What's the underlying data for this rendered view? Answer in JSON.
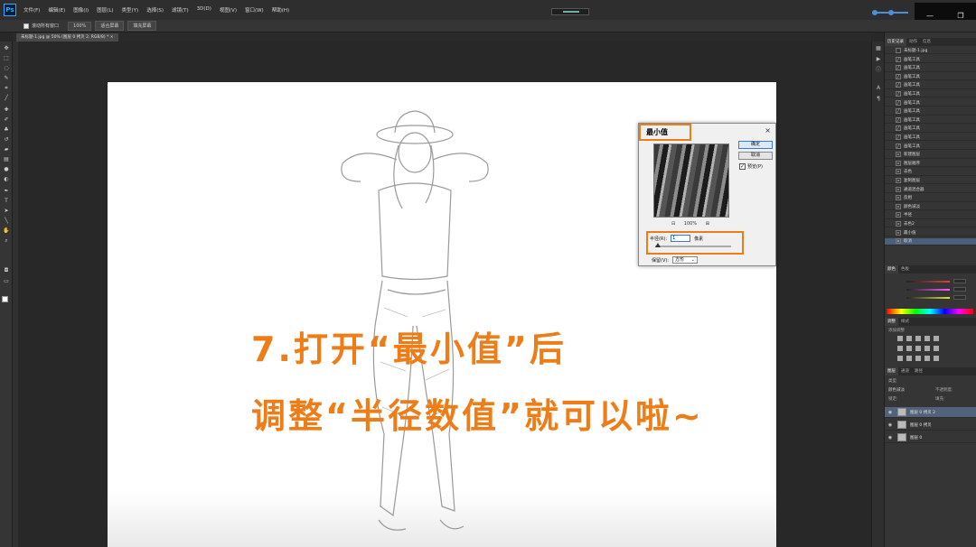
{
  "app": {
    "logo": "Ps",
    "menu": [
      "文件(F)",
      "编辑(E)",
      "图像(I)",
      "图层(L)",
      "类型(Y)",
      "选择(S)",
      "滤镜(T)",
      "3D(D)",
      "视图(V)",
      "窗口(W)",
      "帮助(H)"
    ],
    "window_controls": [
      "—",
      "❐"
    ]
  },
  "options": {
    "checkbox_label": "滚动所有窗口",
    "buttons": [
      "100%",
      "适合屏幕",
      "填充屏幕"
    ]
  },
  "document": {
    "tab_label": "未标题-1.jpg @ 50% (图层 0 拷贝 2, RGB/8) *  ×"
  },
  "caption": {
    "line1": "7.打开“最小值”后",
    "line2": "调整“半径数值”就可以啦~",
    "color": "#ee7d17"
  },
  "dialog": {
    "title": "最小值",
    "close": "×",
    "ok_label": "确定",
    "cancel_label": "取消",
    "preview_label": "预览(P)",
    "preview_check": "✓",
    "zoom_out": "⊟",
    "zoom_level": "100%",
    "zoom_in": "⊞",
    "radius_label": "半径(R):",
    "radius_value": "1",
    "radius_unit": "像素",
    "keep_label": "保留(V):",
    "keep_value": "方形",
    "keep_arrow": "⌄"
  },
  "history": {
    "tabs": [
      "历史记录",
      "动作",
      "信息"
    ],
    "snapshot": "未标题-1.jpg",
    "items": [
      "画笔工具",
      "画笔工具",
      "画笔工具",
      "画笔工具",
      "画笔工具",
      "画笔工具",
      "画笔工具",
      "画笔工具",
      "画笔工具",
      "画笔工具",
      "画笔工具",
      "新建图层",
      "图层顺序",
      "去色",
      "复制图层",
      "通道混合器",
      "反相",
      "颜色减淡",
      "半径",
      "去色2",
      "最小值",
      "取消"
    ],
    "selected_index": 21
  },
  "color_panel": {
    "tabs": [
      "颜色",
      "色板"
    ],
    "slider_colors": [
      "#e04040",
      "#ff5cff",
      "#e0e040"
    ]
  },
  "adjustments": {
    "tabs": [
      "调整",
      "样式"
    ],
    "header": "添加调整"
  },
  "layers": {
    "tabs": [
      "图层",
      "通道",
      "路径"
    ],
    "kind_label": "类型",
    "blend_mode": "颜色减淡",
    "opacity_label": "不透明度:",
    "fill_label": "填充:",
    "lock_label": "锁定:",
    "items": [
      {
        "name": "图层 0 拷贝 2",
        "selected": true
      },
      {
        "name": "图层 0 拷贝",
        "selected": false
      },
      {
        "name": "图层 0",
        "selected": false
      }
    ]
  }
}
